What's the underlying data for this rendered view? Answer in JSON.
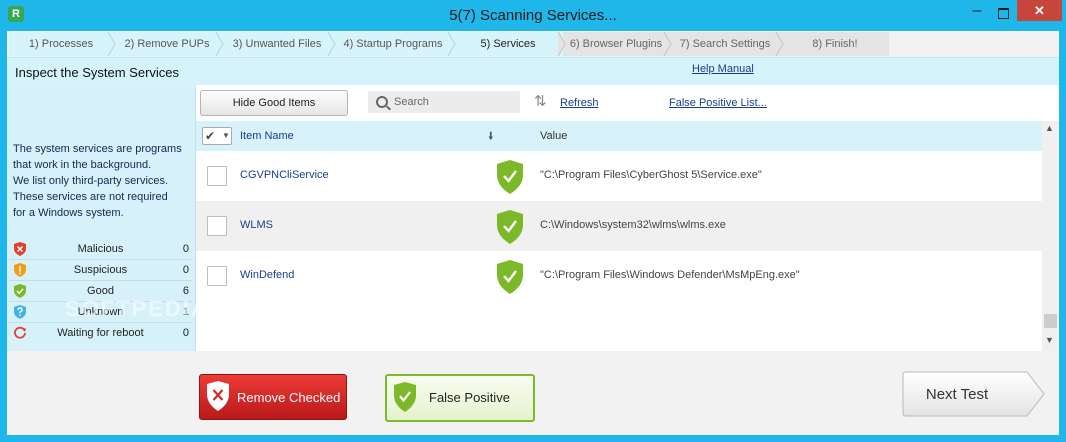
{
  "window": {
    "title": "5(7) Scanning Services...",
    "app_icon_glyph": "R",
    "minimize_glyph": "–",
    "close_glyph": "✕"
  },
  "steps": [
    {
      "label": "1) Processes",
      "state": "done"
    },
    {
      "label": "2) Remove PUPs",
      "state": "done"
    },
    {
      "label": "3) Unwanted Files",
      "state": "done"
    },
    {
      "label": "4) Startup Programs",
      "state": "done"
    },
    {
      "label": "5) Services",
      "state": "current"
    },
    {
      "label": "6) Browser Plugins",
      "state": "todo"
    },
    {
      "label": "7) Search Settings",
      "state": "todo"
    },
    {
      "label": "8) Finish!",
      "state": "todo"
    }
  ],
  "header": {
    "section_title": "Inspect the System Services",
    "help_link": "Help Manual"
  },
  "sidebar": {
    "info_lines": [
      "The system services are programs",
      "that work in the background.",
      "We list only third-party services.",
      "These services are not required",
      "for a Windows system."
    ],
    "stats": [
      {
        "label": "Malicious",
        "count": "0",
        "icon": "red-shield-x-icon",
        "color": "#e2402f"
      },
      {
        "label": "Suspicious",
        "count": "0",
        "icon": "orange-shield-exclamation-icon",
        "color": "#f29b16"
      },
      {
        "label": "Good",
        "count": "6",
        "icon": "green-shield-check-icon",
        "color": "#7bb928"
      },
      {
        "label": "Unknown",
        "count": "1",
        "icon": "blue-shield-question-icon",
        "color": "#41b2e8"
      },
      {
        "label": "Waiting for reboot",
        "count": "0",
        "icon": "reboot-icon",
        "color": "#e2402f"
      }
    ]
  },
  "toolbar": {
    "hide_good_label": "Hide Good Items",
    "search_placeholder": "Search",
    "refresh_label": "Refresh",
    "false_positive_list_label": "False Positive List..."
  },
  "table": {
    "columns": {
      "name": "Item Name",
      "value": "Value"
    },
    "rows": [
      {
        "name": "CGVPNCliService",
        "value": "\"C:\\Program Files\\CyberGhost 5\\Service.exe\"",
        "status": "good"
      },
      {
        "name": "WLMS",
        "value": "C:\\Windows\\system32\\wlms\\wlms.exe",
        "status": "good"
      },
      {
        "name": "WinDefend",
        "value": "\"C:\\Program Files\\Windows Defender\\MsMpEng.exe\"",
        "status": "good"
      }
    ]
  },
  "watermark": "SOFTPEDIA",
  "buttons": {
    "remove_checked": "Remove Checked",
    "false_positive": "False Positive",
    "next_test": "Next Test"
  },
  "colors": {
    "title_bar": "#1fb6ea",
    "good_green": "#7bb928",
    "remove_red": "#d42a27",
    "link_blue": "#1a3e8a"
  }
}
